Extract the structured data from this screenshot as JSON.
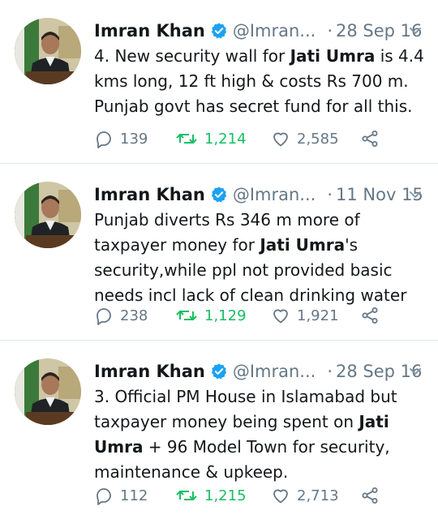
{
  "tweets": [
    {
      "name": "Imran Khan",
      "handle": "@Imran...",
      "date": "28 Sep 16",
      "text_parts": [
        {
          "t": "4. New security wall for "
        },
        {
          "t": "Jati Umra",
          "b": true
        },
        {
          "t": " is 4.4 kms long, 12 ft high & costs Rs 700 m. Punjab govt has secret fund for all this."
        }
      ],
      "replies": "139",
      "retweets": "1,214",
      "likes": "2,585"
    },
    {
      "name": "Imran Khan",
      "handle": "@Imran...",
      "date": "11 Nov 15",
      "text_parts": [
        {
          "t": "Punjab diverts Rs 346 m more of taxpayer money for "
        },
        {
          "t": "Jati Umra",
          "b": true
        },
        {
          "t": "'s security,while ppl not provided basic needs incl lack of clean drinking water"
        }
      ],
      "replies": "238",
      "retweets": "1,129",
      "likes": "1,921"
    },
    {
      "name": "Imran Khan",
      "handle": "@Imran...",
      "date": "28 Sep 16",
      "text_parts": [
        {
          "t": "3. Official PM House in Islamabad but taxpayer money being spent on "
        },
        {
          "t": "Jati Umra",
          "b": true
        },
        {
          "t": " + 96 Model Town for security, maintenance & upkeep."
        }
      ],
      "replies": "112",
      "retweets": "1,215",
      "likes": "2,713"
    }
  ],
  "icons": {
    "reply": "reply-icon",
    "retweet": "retweet-icon",
    "like": "heart-icon",
    "share": "share-icon",
    "verified": "verified-badge-icon",
    "caret": "chevron-down-icon"
  },
  "colors": {
    "verified": "#1da1f2",
    "retweet": "#17bf63",
    "secondary_text": "#657786",
    "divider": "#e1e8ed"
  }
}
